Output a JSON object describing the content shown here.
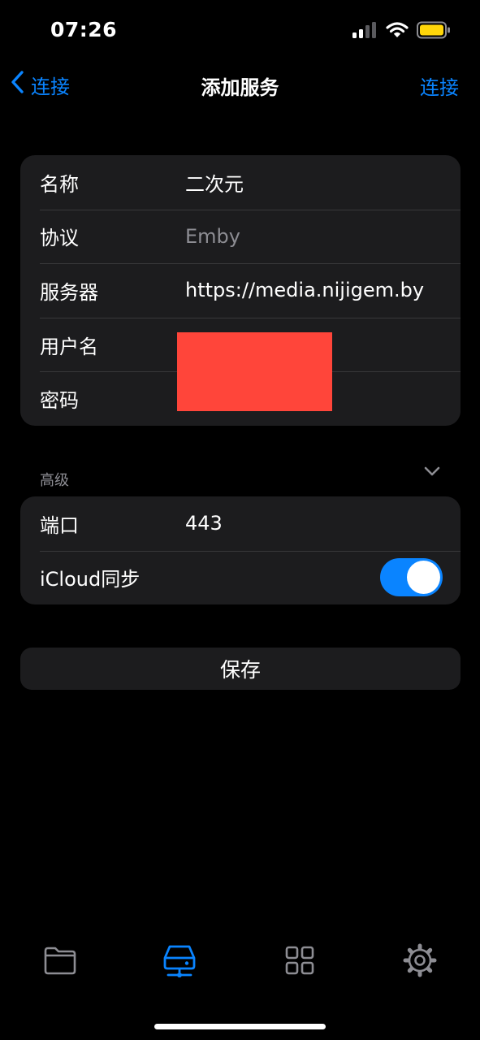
{
  "status_bar": {
    "time": "07:26",
    "battery_color": "#ffd60a"
  },
  "nav": {
    "back_label": "连接",
    "title": "添加服务",
    "action_label": "连接"
  },
  "colors": {
    "accent": "#0a84ff",
    "background": "#000000",
    "cell_background": "#1c1c1e",
    "redaction": "#ff453a"
  },
  "form": {
    "rows": [
      {
        "label": "名称",
        "value": "二次元"
      },
      {
        "label": "协议",
        "value": "Emby"
      },
      {
        "label": "服务器",
        "value": "https://media.nijigem.by"
      },
      {
        "label": "用户名",
        "value": ""
      },
      {
        "label": "密码",
        "value": ""
      }
    ]
  },
  "advanced": {
    "header": "高级",
    "port": {
      "label": "端口",
      "value": "443"
    },
    "icloud_sync": {
      "label": "iCloud同步",
      "enabled": true
    }
  },
  "save_label": "保存",
  "tab_bar": {
    "items": [
      {
        "icon": "folder-icon",
        "selected": false
      },
      {
        "icon": "server-icon",
        "selected": true
      },
      {
        "icon": "grid-icon",
        "selected": false
      },
      {
        "icon": "gear-icon",
        "selected": false
      }
    ]
  }
}
